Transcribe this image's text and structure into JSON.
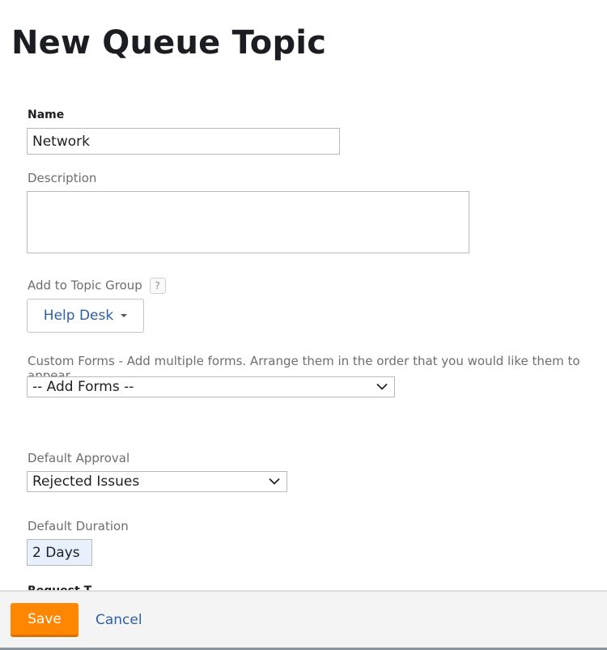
{
  "page": {
    "title": "New Queue Topic"
  },
  "form": {
    "name": {
      "label": "Name",
      "value": "Network"
    },
    "description": {
      "label": "Description",
      "value": ""
    },
    "topic_group": {
      "label": "Add to Topic Group",
      "help_icon": "?",
      "selected": "Help Desk"
    },
    "custom_forms": {
      "label": "Custom Forms - Add multiple forms. Arrange them in the order that you would like them to appear.",
      "selected": "-- Add Forms --"
    },
    "default_approval": {
      "label": "Default Approval",
      "selected": "Rejected Issues"
    },
    "default_duration": {
      "label": "Default Duration",
      "value": "2 Days"
    },
    "next_field_label_partial": "Request T..."
  },
  "footer": {
    "save_label": "Save",
    "cancel_label": "Cancel"
  },
  "colors": {
    "accent": "#ff8600",
    "link": "#2d5ea8"
  }
}
